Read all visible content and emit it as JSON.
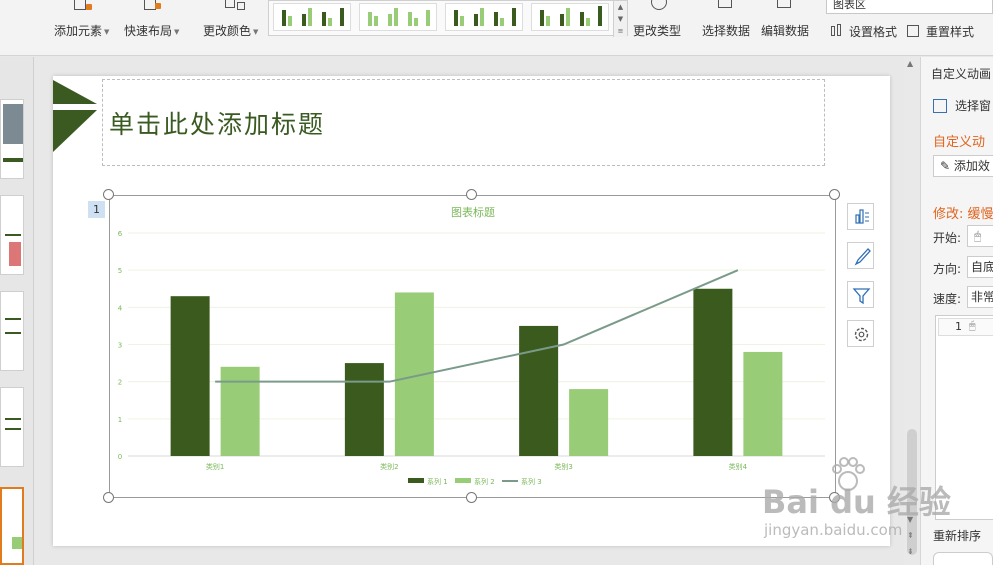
{
  "ribbon": {
    "add_element": "添加元素",
    "quick_layout": "快速布局",
    "change_color": "更改颜色",
    "change_type": "更改类型",
    "select_data": "选择数据",
    "edit_data": "编辑数据",
    "chart_area": "图表区",
    "set_format": "设置格式",
    "reset_style": "重置样式"
  },
  "slide": {
    "title_placeholder": "单击此处添加标题",
    "anim_badge": "1"
  },
  "right_panel": {
    "header": "自定义动画",
    "select_pane": "选择窗",
    "section_title": "自定义动",
    "add_effect": "添加效",
    "modify": "修改: 缓慢",
    "start_label": "开始:",
    "direction_label": "方向:",
    "direction_value": "自底",
    "speed_label": "速度:",
    "speed_value": "非常",
    "list_item_num": "1",
    "reorder": "重新排序"
  },
  "watermark": {
    "brand": "Bai du 经验",
    "url": "jingyan.baidu.com"
  },
  "colors": {
    "series1": "#3b5a1e",
    "series2": "#99cc77",
    "series3": "#7a9a8a",
    "accent_text": "#7ab85a",
    "title": "#3a5a22"
  },
  "chart_data": {
    "type": "bar",
    "title": "图表标题",
    "categories": [
      "类别1",
      "类别2",
      "类别3",
      "类别4"
    ],
    "series": [
      {
        "name": "系列 1",
        "type": "bar",
        "values": [
          4.3,
          2.5,
          3.5,
          4.5
        ]
      },
      {
        "name": "系列 2",
        "type": "bar",
        "values": [
          2.4,
          4.4,
          1.8,
          2.8
        ]
      },
      {
        "name": "系列 3",
        "type": "line",
        "values": [
          2,
          2,
          3,
          5
        ]
      }
    ],
    "ylim": [
      0,
      6
    ],
    "yticks": [
      "0",
      "1",
      "2",
      "3",
      "4",
      "5",
      "6"
    ],
    "grid": true,
    "legend": "bottom"
  }
}
